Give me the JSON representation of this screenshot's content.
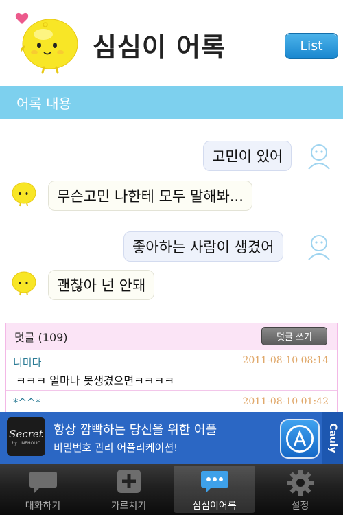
{
  "header": {
    "title": "심심이 어록",
    "list_button": "List"
  },
  "section": {
    "title": "어록 내용"
  },
  "chat": {
    "messages": [
      {
        "from": "user",
        "text": "고민이 있어"
      },
      {
        "from": "bot",
        "text": "무슨고민 나한테 모두 말해봐..."
      },
      {
        "from": "user",
        "text": "좋아하는 사람이 생겼어"
      },
      {
        "from": "bot",
        "text": "괜찮아 넌 안돼"
      }
    ]
  },
  "comments": {
    "header": "덧글 (109)",
    "write_button": "덧글 쓰기",
    "items": [
      {
        "author": "니미다",
        "time": "2011-08-10 08:14",
        "text": "ㅋㅋㅋ 얼마나 못생겼으면ㅋㅋㅋㅋ"
      },
      {
        "author": "*^^*",
        "time": "2011-08-10 01:42",
        "text": ""
      }
    ]
  },
  "ad": {
    "logo_main": "Secret",
    "logo_sub": "by LINEHOLIC",
    "line1": "항상 깜빡하는 당신을 위한 어플",
    "line2": "비밀번호 관리 어플리케이션!",
    "side_label": "Cauly"
  },
  "tabbar": {
    "tabs": [
      {
        "label": "대화하기",
        "icon": "chat-bubble-icon",
        "active": false
      },
      {
        "label": "가르치기",
        "icon": "plus-icon",
        "active": false
      },
      {
        "label": "심심이어록",
        "icon": "speech-dots-icon",
        "active": true
      },
      {
        "label": "설정",
        "icon": "gear-icon",
        "active": false
      }
    ]
  },
  "colors": {
    "section_bar": "#7dd0ee",
    "list_button": "#1a87cf",
    "ad_background": "#2b67c4",
    "comment_header": "#fbe4f6"
  }
}
